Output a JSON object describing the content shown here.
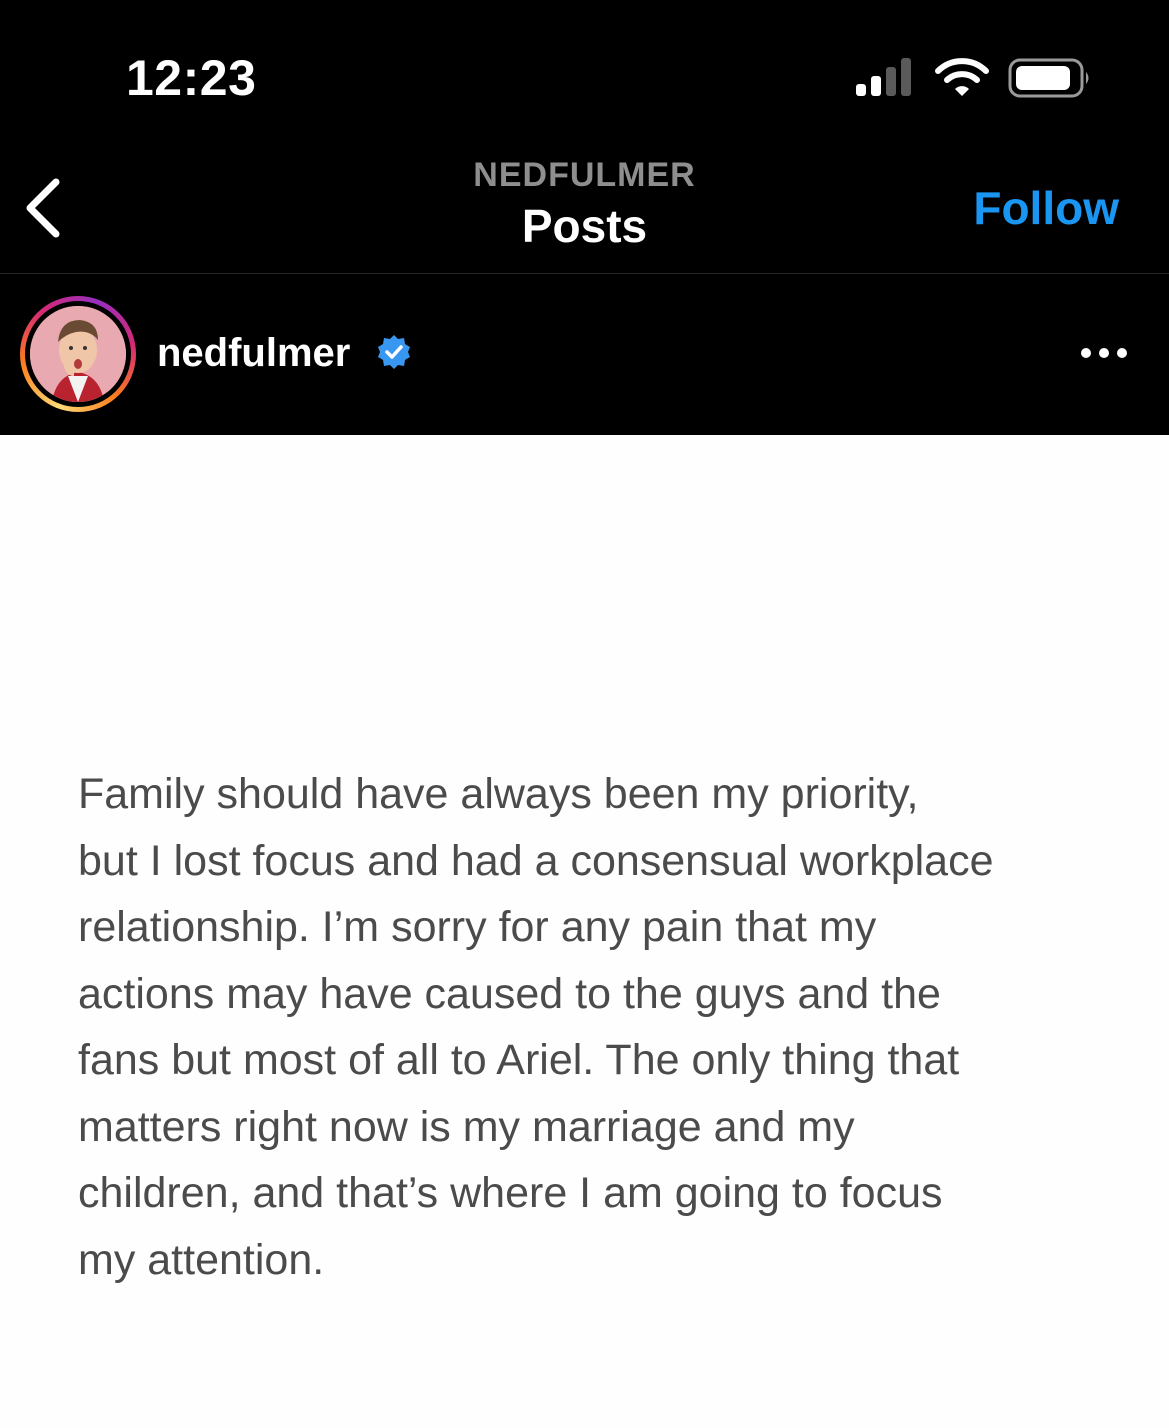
{
  "status_bar": {
    "time": "12:23",
    "signal_icon": "cellular-signal-icon",
    "wifi_icon": "wifi-icon",
    "battery_icon": "battery-icon"
  },
  "nav": {
    "back_icon": "chevron-left-icon",
    "subtitle": "NEDFULMER",
    "title": "Posts",
    "follow_label": "Follow"
  },
  "post": {
    "username": "nedfulmer",
    "verified": true,
    "more_icon": "ellipsis-icon",
    "image_text": "Family should have always been my priority,\nbut I lost focus and had a consensual workplace\nrelationship.  I’m sorry for any pain that my\nactions may have caused to the guys and the\nfans but most of all to Ariel. The only thing that\nmatters right now is my marriage and my\nchildren, and that’s where I am going to focus\nmy attention."
  },
  "colors": {
    "background": "#000000",
    "accent": "#1a95f1",
    "subtitle": "#8e8e8e",
    "post_text": "#4b4b4b",
    "post_background": "#fefefe"
  }
}
